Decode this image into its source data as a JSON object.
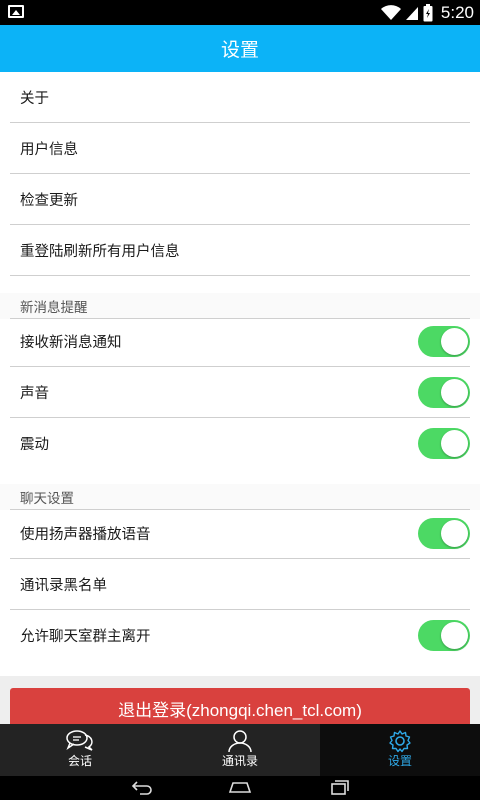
{
  "status_bar": {
    "time": "5:20"
  },
  "app_bar": {
    "title": "设置"
  },
  "settings": {
    "general": [
      {
        "label": "关于"
      },
      {
        "label": "用户信息"
      },
      {
        "label": "检查更新"
      },
      {
        "label": "重登陆刷新所有用户信息"
      }
    ],
    "notifications_header": "新消息提醒",
    "notifications": [
      {
        "label": "接收新消息通知",
        "enabled": true
      },
      {
        "label": "声音",
        "enabled": true
      },
      {
        "label": "震动",
        "enabled": true
      }
    ],
    "chat_header": "聊天设置",
    "chat": [
      {
        "label": "使用扬声器播放语音",
        "enabled": true
      },
      {
        "label": "通讯录黑名单"
      },
      {
        "label": "允许聊天室群主离开",
        "enabled": true
      }
    ]
  },
  "logout_button": "退出登录(zhongqi.chen_tcl.com)",
  "bottom_nav": {
    "items": [
      {
        "label": "会话",
        "icon": "chat-icon"
      },
      {
        "label": "通讯录",
        "icon": "contacts-icon"
      },
      {
        "label": "设置",
        "icon": "gear-icon",
        "active": true
      }
    ]
  },
  "colors": {
    "app_bar": "#0cb3f7",
    "toggle_on": "#4cd964",
    "logout": "#d9413e",
    "nav_active": "#2fa9e8"
  }
}
